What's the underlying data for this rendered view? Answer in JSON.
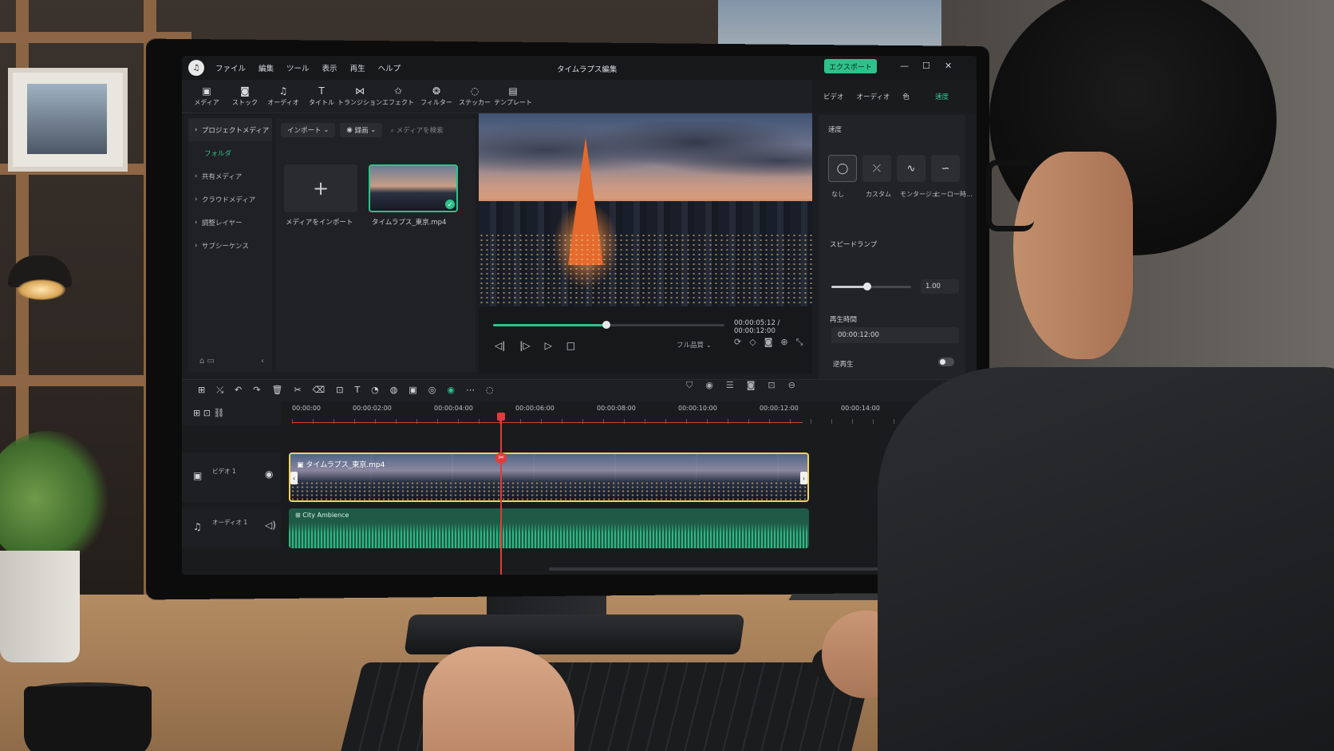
{
  "app": {
    "title": "タイムラプス編集",
    "logo_icon": "app-logo-icon",
    "export_label": "エクスポート",
    "window_controls": [
      "—",
      "☐",
      "✕"
    ]
  },
  "menu": [
    "ファイル",
    "編集",
    "ツール",
    "表示",
    "再生",
    "ヘルプ"
  ],
  "toolbar": [
    {
      "icon": "media-icon",
      "glyph": "▣",
      "label": "メディア"
    },
    {
      "icon": "stock-icon",
      "glyph": "◙",
      "label": "ストック"
    },
    {
      "icon": "audio-icon",
      "glyph": "♫",
      "label": "オーディオ"
    },
    {
      "icon": "title-icon",
      "glyph": "T",
      "label": "タイトル"
    },
    {
      "icon": "transition-icon",
      "glyph": "⋈",
      "label": "トランジション"
    },
    {
      "icon": "effect-icon",
      "glyph": "✩",
      "label": "エフェクト"
    },
    {
      "icon": "filter-icon",
      "glyph": "❂",
      "label": "フィルター"
    },
    {
      "icon": "sticker-icon",
      "glyph": "◌",
      "label": "ステッカー"
    },
    {
      "icon": "template-icon",
      "glyph": "▤",
      "label": "テンプレート"
    }
  ],
  "right_tabs": {
    "video": "ビデオ",
    "audio": "オーディオ",
    "color": "色",
    "speed": "速度"
  },
  "sidebar": {
    "project_media": "プロジェクトメディア",
    "folder": "フォルダ",
    "items": [
      "共有メディア",
      "クラウドメディア",
      "調整レイヤー",
      "サブシーケンス"
    ]
  },
  "media": {
    "import_button": "インポート",
    "record_button": "録画",
    "search_placeholder": "メディアを検索",
    "import_tile_label": "メディアをインポート",
    "clip_name": "タイムラプス_東京.mp4"
  },
  "player": {
    "current_time": "00:00:05:12",
    "total_time": "00:00:12:00",
    "progress": 0.49,
    "quality": "フル品質"
  },
  "speed_panel": {
    "heading": "速度",
    "presets": [
      {
        "icon": "none-speed-icon",
        "glyph": "◯",
        "label": "なし"
      },
      {
        "icon": "custom-speed-icon",
        "glyph": "⤫",
        "label": "カスタム"
      },
      {
        "icon": "montage-speed-icon",
        "glyph": "∿",
        "label": "モンタージュ"
      },
      {
        "icon": "hero-time-speed-icon",
        "glyph": "∽",
        "label": "ヒーロー時..."
      }
    ],
    "speed_ramp_label": "スピードランプ",
    "speed_value": "1.00",
    "speed_fraction": 0.45,
    "duration_label": "再生時間",
    "duration_value": "00:00:12:00",
    "reverse_label": "逆再生",
    "reverse_on": false
  },
  "timeline": {
    "ticks": [
      "00:00:00",
      "00:00:02:00",
      "00:00:04:00",
      "00:00:06:00",
      "00:00:08:00",
      "00:00:10:00",
      "00:00:12:00",
      "00:00:14:00"
    ],
    "video_track_name": "ビデオ 1",
    "audio_track_name": "オーディオ 1",
    "video_clip_label": "タイムラプス_東京.mp4",
    "audio_clip_label": "City Ambience",
    "playhead_seconds": 5.12
  },
  "colors": {
    "accent": "#2fc18b",
    "clip_border": "#f2d35c",
    "playhead": "#e23b3b"
  }
}
